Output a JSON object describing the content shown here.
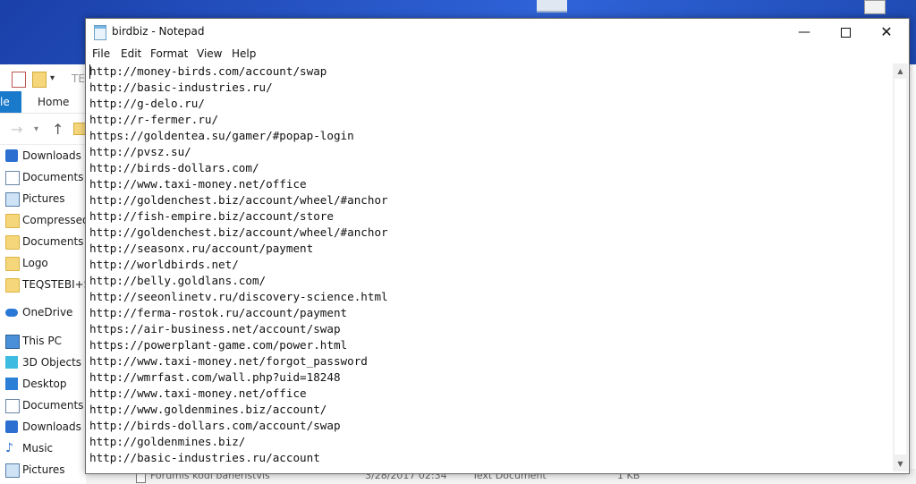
{
  "explorer": {
    "file_tab": "le",
    "home_tab": "Home",
    "path_stub": "TE",
    "sidebar": [
      {
        "label": "Downloads",
        "icon": "download-icon"
      },
      {
        "label": "Documents",
        "icon": "document-icon"
      },
      {
        "label": "Pictures",
        "icon": "pictures-icon"
      },
      {
        "label": "Compressed",
        "icon": "folder-icon"
      },
      {
        "label": "Documents",
        "icon": "folder-icon"
      },
      {
        "label": "Logo",
        "icon": "folder-icon"
      },
      {
        "label": "TEQSTEBI+Su",
        "icon": "folder-icon"
      },
      {
        "label": "OneDrive",
        "icon": "cloud-icon"
      },
      {
        "label": "This PC",
        "icon": "computer-icon"
      },
      {
        "label": "3D Objects",
        "icon": "cube-icon"
      },
      {
        "label": "Desktop",
        "icon": "desktop-icon"
      },
      {
        "label": "Documents",
        "icon": "document-icon"
      },
      {
        "label": "Downloads",
        "icon": "download-icon"
      },
      {
        "label": "Music",
        "icon": "music-icon"
      },
      {
        "label": "Pictures",
        "icon": "pictures-icon"
      }
    ],
    "file_row": {
      "name": "Forumis kodi baneristvis",
      "date": "3/28/2017 02:34",
      "type": "Text Document",
      "size": "1 KB"
    }
  },
  "notepad": {
    "title": "birdbiz - Notepad",
    "menu": [
      "File",
      "Edit",
      "Format",
      "View",
      "Help"
    ],
    "lines": [
      "http://money-birds.com/account/swap",
      "http://basic-industries.ru/",
      "http://g-delo.ru/",
      "http://r-fermer.ru/",
      "https://goldentea.su/gamer/#popap-login",
      "http://pvsz.su/",
      "http://birds-dollars.com/",
      "http://www.taxi-money.net/office",
      "http://goldenchest.biz/account/wheel/#anchor",
      "http://fish-empire.biz/account/store",
      "http://goldenchest.biz/account/wheel/#anchor",
      "http://seasonx.ru/account/payment",
      "http://worldbirds.net/",
      "http://belly.goldlans.com/",
      "http://seeonlinetv.ru/discovery-science.html",
      "http://ferma-rostok.ru/account/payment",
      "https://air-business.net/account/swap",
      "https://powerplant-game.com/power.html",
      "http://www.taxi-money.net/forgot_password",
      "http://wmrfast.com/wall.php?uid=18248",
      "http://www.taxi-money.net/office",
      "http://www.goldenmines.biz/account/",
      "http://birds-dollars.com/account/swap",
      "http://goldenmines.biz/",
      "http://basic-industries.ru/account"
    ]
  }
}
